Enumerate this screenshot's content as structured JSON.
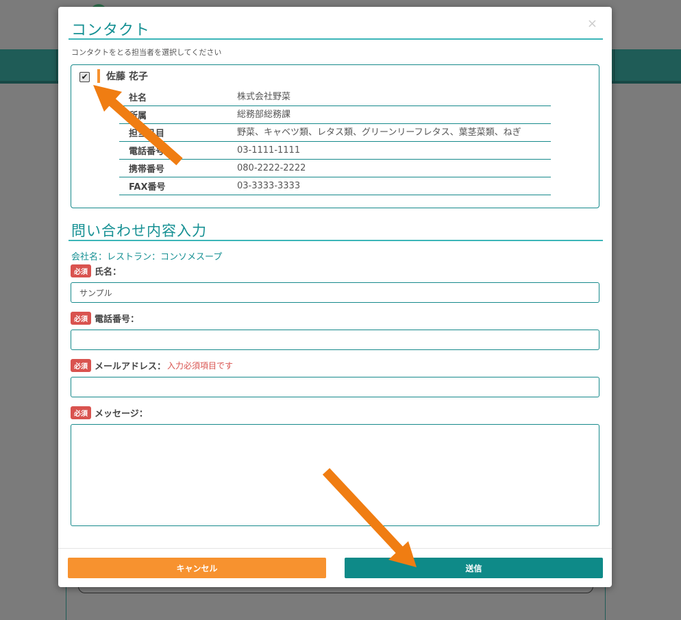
{
  "modal": {
    "title": "コンタクト",
    "close_icon": "×",
    "subtitle": "コンタクトをとる担当者を選択してください",
    "contact": {
      "checked": true,
      "check_mark": "✔",
      "name": "佐藤 花子",
      "rows": [
        {
          "label": "社名",
          "value": "株式会社野菜"
        },
        {
          "label": "所属",
          "value": "総務部総務課"
        },
        {
          "label": "担当品目",
          "value": "野菜、キャベツ類、レタス類、グリーンリーフレタス、葉茎菜類、ねぎ"
        },
        {
          "label": "電話番号",
          "value": "03-1111-1111"
        },
        {
          "label": "携帯番号",
          "value": "080-2222-2222"
        },
        {
          "label": "FAX番号",
          "value": "03-3333-3333"
        }
      ]
    },
    "section_title": "問い合わせ内容入力",
    "company_line": "会社名：レストラン：コンソメスープ",
    "required_badge": "必須",
    "fields": {
      "name": {
        "label": "氏名：",
        "value": "サンプル"
      },
      "phone": {
        "label": "電話番号：",
        "value": ""
      },
      "email": {
        "label": "メールアドレス：",
        "error": "入力必須項目です",
        "value": ""
      },
      "message": {
        "label": "メッセージ：",
        "value": ""
      }
    },
    "buttons": {
      "cancel": "キャンセル",
      "send": "送信"
    }
  },
  "colors": {
    "accent": "#159093",
    "orange": "#f7922f",
    "send": "#0e8a88",
    "required": "#d9534f"
  }
}
